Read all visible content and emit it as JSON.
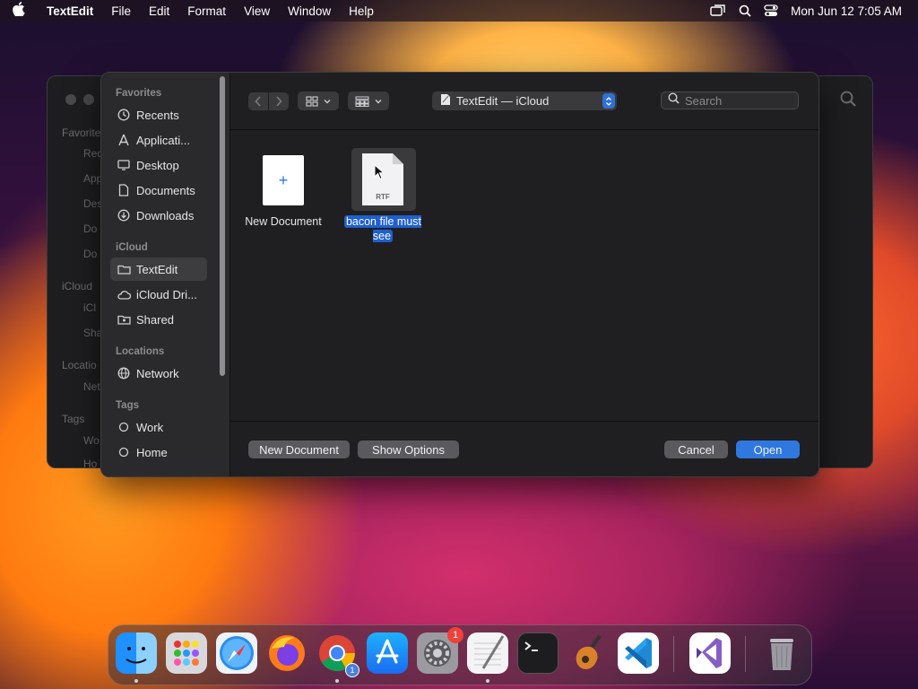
{
  "menubar": {
    "app_name": "TextEdit",
    "items": [
      "File",
      "Edit",
      "Format",
      "View",
      "Window",
      "Help"
    ],
    "clock": "Mon Jun 12  7:05 AM"
  },
  "background_window": {
    "sidebar_fragments": [
      "Favorite",
      "Rec",
      "App",
      "Des",
      "Do",
      "Do",
      "iCloud",
      "iCl",
      "Sha",
      "Locatio",
      "Net",
      "Tags",
      "Wo",
      "Ho"
    ]
  },
  "sidebar": {
    "favorites_header": "Favorites",
    "favorites": [
      {
        "label": "Recents",
        "icon": "clock-icon"
      },
      {
        "label": "Applicati...",
        "icon": "applications-icon"
      },
      {
        "label": "Desktop",
        "icon": "desktop-icon"
      },
      {
        "label": "Documents",
        "icon": "document-icon"
      },
      {
        "label": "Downloads",
        "icon": "download-icon"
      }
    ],
    "icloud_header": "iCloud",
    "icloud": [
      {
        "label": "TextEdit",
        "icon": "folder-icon",
        "selected": true
      },
      {
        "label": "iCloud Dri...",
        "icon": "cloud-icon"
      },
      {
        "label": "Shared",
        "icon": "shared-folder-icon"
      }
    ],
    "locations_header": "Locations",
    "locations": [
      {
        "label": "Network",
        "icon": "network-icon"
      }
    ],
    "tags_header": "Tags",
    "tags": [
      {
        "label": "Work",
        "icon": "tag-circle-icon"
      },
      {
        "label": "Home",
        "icon": "tag-circle-icon"
      }
    ]
  },
  "toolbar": {
    "location": "TextEdit — iCloud",
    "search_placeholder": "Search"
  },
  "files": {
    "new_document_label": "New Document",
    "rtf_badge": "RTF",
    "rtf_name": "bacon file must see"
  },
  "footer": {
    "new_document": "New Document",
    "show_options": "Show Options",
    "cancel": "Cancel",
    "open": "Open"
  },
  "dock": {
    "apps": [
      "finder",
      "launchpad",
      "safari",
      "firefox",
      "chrome",
      "app-store",
      "system-settings",
      "textedit",
      "terminal",
      "garageband",
      "vscode",
      "visual-studio",
      "trash"
    ],
    "chrome_badge": "1",
    "settings_badge": "1"
  }
}
